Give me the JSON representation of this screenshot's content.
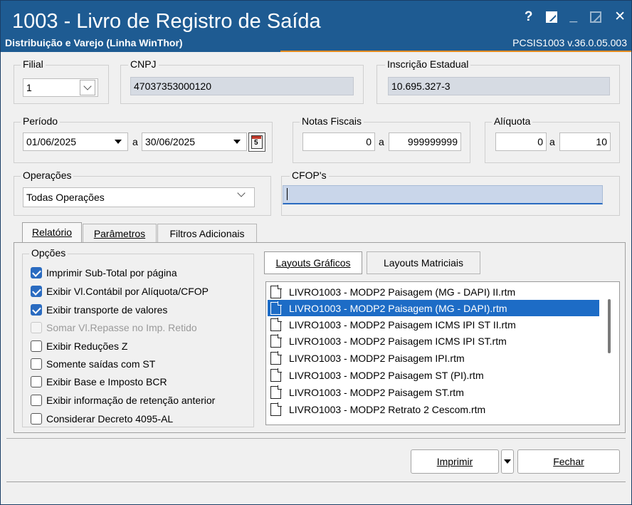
{
  "window": {
    "title": "1003 - Livro de Registro de Saída",
    "subtitle": "Distribuição e Varejo (Linha WinThor)",
    "version": "PCSIS1003  v.36.0.05.003",
    "help_label": "?",
    "minimize_label": "_",
    "close_label": "✕"
  },
  "filial": {
    "label": "Filial",
    "value": "1"
  },
  "cnpj": {
    "label": "CNPJ",
    "value": "47037353000120"
  },
  "inscricao": {
    "label": "Inscrição Estadual",
    "value": "10.695.327-3"
  },
  "periodo": {
    "label": "Período",
    "start": "01/06/2025",
    "sep": "a",
    "end": "30/06/2025",
    "calendar_icon": "calendar-icon",
    "calendar_digit": "5"
  },
  "notas": {
    "label": "Notas Fiscais",
    "from": "0",
    "sep": "a",
    "to": "999999999"
  },
  "aliquota": {
    "label": "Alíquota",
    "from": "0",
    "sep": "a",
    "to": "10"
  },
  "operacoes": {
    "label": "Operações",
    "value": "Todas Operações"
  },
  "cfops": {
    "label": "CFOP's",
    "value": ""
  },
  "tabs": [
    {
      "label": "Relatório"
    },
    {
      "label": "Parâmetros"
    },
    {
      "label": "Filtros Adicionais"
    }
  ],
  "opcoes": {
    "label": "Opções",
    "items": [
      {
        "label": "Imprimir Sub-Total por página",
        "checked": true,
        "enabled": true
      },
      {
        "label": "Exibir Vl.Contábil por Alíquota/CFOP",
        "checked": true,
        "enabled": true
      },
      {
        "label": "Exibir transporte de valores",
        "checked": true,
        "enabled": true
      },
      {
        "label": "Somar Vl.Repasse no Imp. Retido",
        "checked": false,
        "enabled": false
      },
      {
        "label": "Exibir Reduções Z",
        "checked": false,
        "enabled": true
      },
      {
        "label": "Somente saídas com ST",
        "checked": false,
        "enabled": true
      },
      {
        "label": "Exibir Base e Imposto BCR",
        "checked": false,
        "enabled": true
      },
      {
        "label": "Exibir informação de retenção anterior",
        "checked": false,
        "enabled": true
      },
      {
        "label": "Considerar Decreto 4095-AL",
        "checked": false,
        "enabled": true
      }
    ]
  },
  "layouts": {
    "tab_graficos": "Layouts Gráficos",
    "tab_matriciais": "Layouts Matriciais",
    "items": [
      "LIVRO1003 - MODP2 Paisagem (MG - DAPI) II.rtm",
      "LIVRO1003 - MODP2 Paisagem (MG - DAPI).rtm",
      "LIVRO1003 - MODP2 Paisagem ICMS IPI ST II.rtm",
      "LIVRO1003 - MODP2 Paisagem ICMS IPI ST.rtm",
      "LIVRO1003 - MODP2 Paisagem IPI.rtm",
      "LIVRO1003 - MODP2 Paisagem ST (PI).rtm",
      "LIVRO1003 - MODP2 Paisagem ST.rtm",
      "LIVRO1003 - MODP2 Retrato 2 Cescom.rtm"
    ],
    "selected_index": 1
  },
  "buttons": {
    "imprimir": "Imprimir",
    "fechar": "Fechar"
  },
  "colors": {
    "titlebar": "#1e5b92",
    "accent": "#e38b1f",
    "selection": "#1d6cc6",
    "readonly": "#d6dbe3"
  }
}
